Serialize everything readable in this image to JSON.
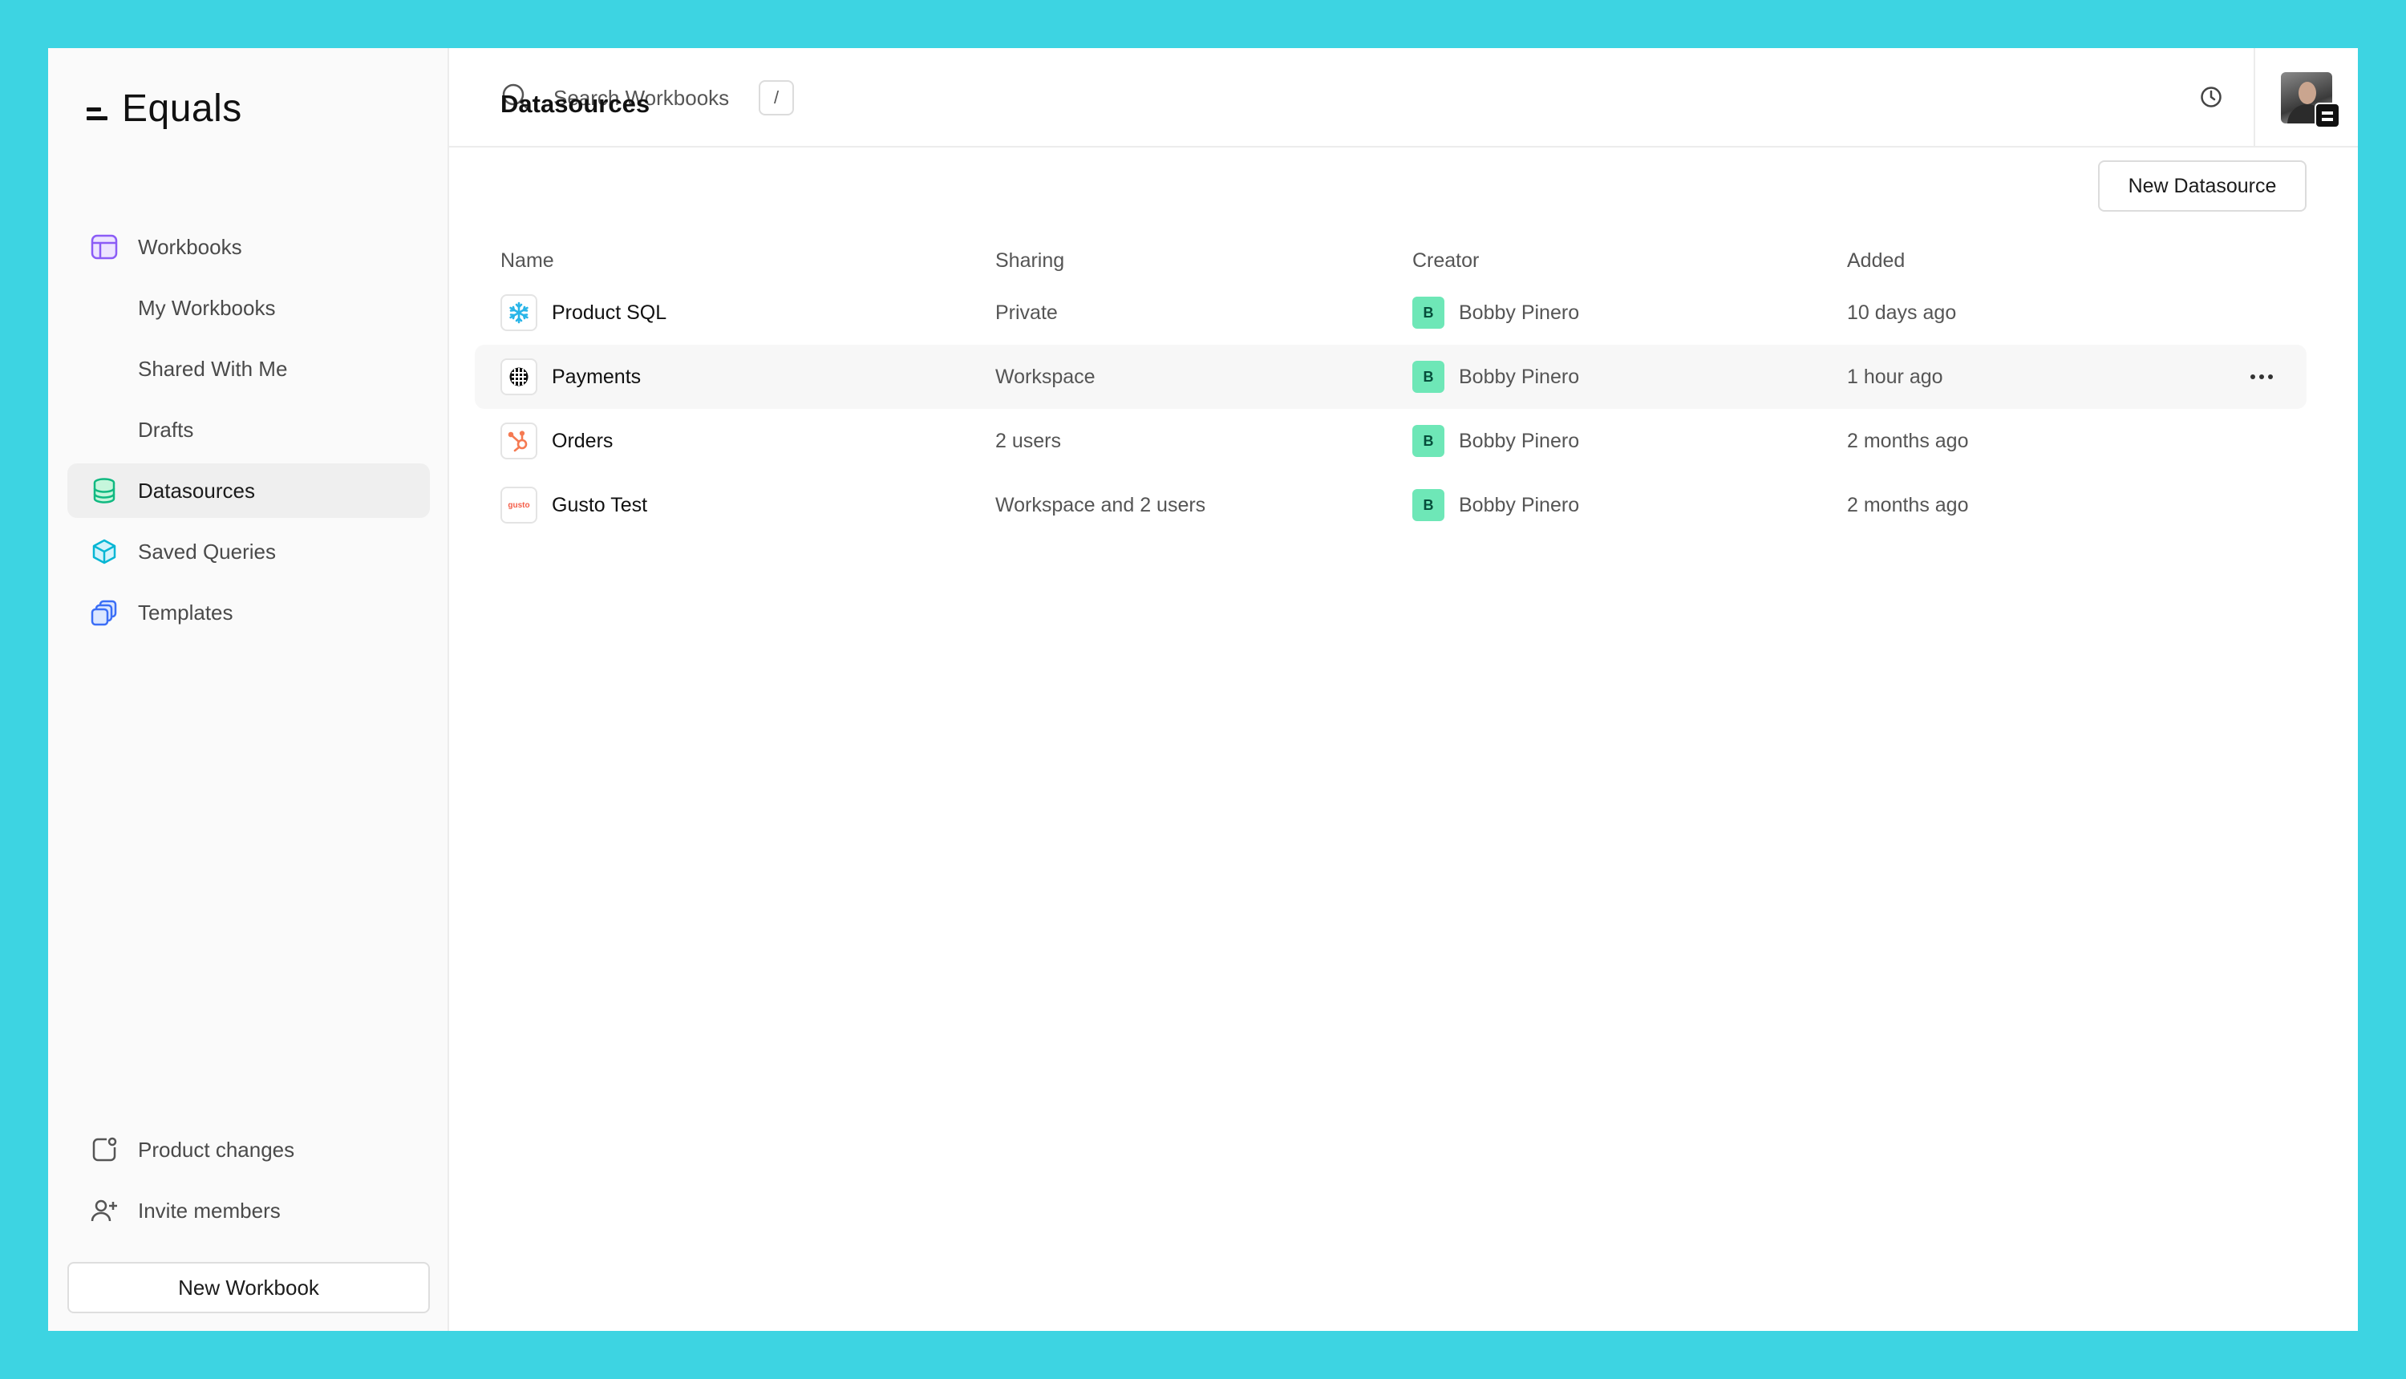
{
  "app": {
    "logo_text": "Equals"
  },
  "sidebar": {
    "items": [
      {
        "label": "Workbooks",
        "icon": "workbook-icon"
      },
      {
        "label": "My Workbooks"
      },
      {
        "label": "Shared With Me"
      },
      {
        "label": "Drafts"
      },
      {
        "label": "Datasources",
        "icon": "database-icon",
        "active": true
      },
      {
        "label": "Saved Queries",
        "icon": "cube-icon"
      },
      {
        "label": "Templates",
        "icon": "templates-icon"
      }
    ],
    "bottom_items": [
      {
        "label": "Product changes",
        "icon": "product-changes-icon"
      },
      {
        "label": "Invite members",
        "icon": "invite-user-icon"
      }
    ],
    "new_workbook_label": "New Workbook"
  },
  "topbar": {
    "search_placeholder": "Search Workbooks",
    "search_shortcut": "/"
  },
  "page": {
    "title": "Datasources",
    "new_button_label": "New Datasource"
  },
  "table": {
    "columns": [
      "Name",
      "Sharing",
      "Creator",
      "Added"
    ],
    "rows": [
      {
        "name": "Product SQL",
        "icon": "snowflake-icon",
        "sharing": "Private",
        "creator_initial": "B",
        "creator": "Bobby Pinero",
        "added": "10 days ago"
      },
      {
        "name": "Payments",
        "icon": "stripe-like-icon",
        "sharing": "Workspace",
        "creator_initial": "B",
        "creator": "Bobby Pinero",
        "added": "1 hour ago"
      },
      {
        "name": "Orders",
        "icon": "hubspot-icon",
        "sharing": "2 users",
        "creator_initial": "B",
        "creator": "Bobby Pinero",
        "added": "2 months ago"
      },
      {
        "name": "Gusto Test",
        "icon": "gusto-icon",
        "icon_text": "gusto",
        "sharing": "Workspace and 2 users",
        "creator_initial": "B",
        "creator": "Bobby Pinero",
        "added": "2 months ago"
      }
    ]
  },
  "colors": {
    "background": "#3dd4e2",
    "creator_badge": "#6ee7b7",
    "hubspot": "#f57a52",
    "snowflake": "#29b5e8",
    "gusto": "#f45d48"
  }
}
